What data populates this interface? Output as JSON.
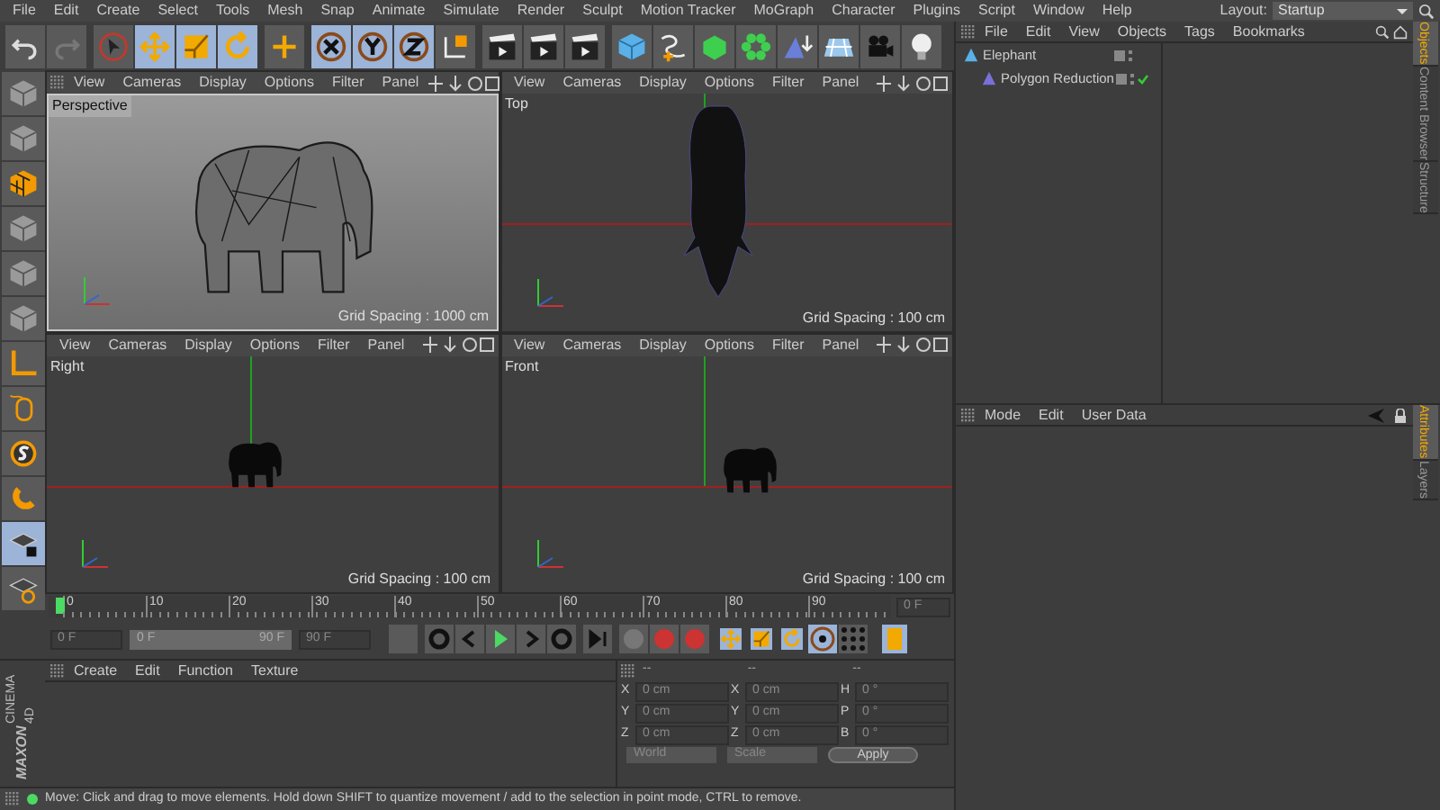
{
  "menu": [
    "File",
    "Edit",
    "Create",
    "Select",
    "Tools",
    "Mesh",
    "Snap",
    "Animate",
    "Simulate",
    "Render",
    "Sculpt",
    "Motion Tracker",
    "MoGraph",
    "Character",
    "Plugins",
    "Script",
    "Window",
    "Help"
  ],
  "layout": {
    "label": "Layout:",
    "value": "Startup"
  },
  "toolbar": [
    {
      "kind": "undo",
      "selected": false
    },
    {
      "kind": "redo",
      "selected": false
    },
    {
      "kind": "pointer",
      "selected": false
    },
    {
      "kind": "move",
      "selected": true
    },
    {
      "kind": "scale",
      "selected": true
    },
    {
      "kind": "rotate",
      "selected": true
    },
    {
      "kind": "add",
      "selected": false
    },
    {
      "kind": "x",
      "selected": true
    },
    {
      "kind": "y",
      "selected": true
    },
    {
      "kind": "z",
      "selected": true
    },
    {
      "kind": "coords",
      "selected": false
    },
    {
      "kind": "render",
      "selected": false
    },
    {
      "kind": "render",
      "selected": false
    },
    {
      "kind": "render",
      "selected": false
    },
    {
      "kind": "cube",
      "selected": false
    },
    {
      "kind": "spline",
      "selected": false
    },
    {
      "kind": "generator",
      "selected": false
    },
    {
      "kind": "array",
      "selected": false
    },
    {
      "kind": "deformer",
      "selected": false
    },
    {
      "kind": "floor",
      "selected": false
    },
    {
      "kind": "camera",
      "selected": false
    },
    {
      "kind": "light",
      "selected": false
    }
  ],
  "side_tools": [
    {
      "kind": "object",
      "selected": false
    },
    {
      "kind": "object",
      "selected": false
    },
    {
      "kind": "texture",
      "selected": false
    },
    {
      "kind": "object",
      "selected": false
    },
    {
      "kind": "object",
      "selected": false
    },
    {
      "kind": "object",
      "selected": false
    },
    {
      "kind": "angle",
      "selected": false
    },
    {
      "kind": "mouse",
      "selected": false
    },
    {
      "kind": "snap",
      "selected": false
    },
    {
      "kind": "magnet",
      "selected": false
    },
    {
      "kind": "lock",
      "selected": true
    },
    {
      "kind": "workplane",
      "selected": false
    }
  ],
  "viewports": [
    {
      "menu": [
        "View",
        "Cameras",
        "Display",
        "Options",
        "Filter",
        "Panel"
      ],
      "name": "Perspective",
      "kind": "perspective",
      "grid": "Grid Spacing : 1000 cm"
    },
    {
      "menu": [
        "View",
        "Cameras",
        "Display",
        "Options",
        "Filter",
        "Panel"
      ],
      "name": "Top",
      "kind": "top",
      "grid": "Grid Spacing : 100 cm"
    },
    {
      "menu": [
        "View",
        "Cameras",
        "Display",
        "Options",
        "Filter",
        "Panel"
      ],
      "name": "Right",
      "kind": "right",
      "grid": "Grid Spacing : 100 cm"
    },
    {
      "menu": [
        "View",
        "Cameras",
        "Display",
        "Options",
        "Filter",
        "Panel"
      ],
      "name": "Front",
      "kind": "front",
      "grid": "Grid Spacing : 100 cm"
    }
  ],
  "timeline": {
    "ruler": [
      "0",
      "10",
      "20",
      "30",
      "40",
      "50",
      "60",
      "70",
      "80",
      "90"
    ],
    "current": "0 F",
    "start": "0 F",
    "range_start": "0 F",
    "range_end": "90 F",
    "range": {
      "level": 1
    },
    "end": "90 F"
  },
  "material_menu": [
    "Create",
    "Edit",
    "Function",
    "Texture"
  ],
  "logo": {
    "brand": "MAXON",
    "product": "CINEMA 4D"
  },
  "coordinates": {
    "headers": [
      "--",
      "--",
      "--"
    ],
    "rows": [
      [
        "X",
        "0 cm",
        "X",
        "0 cm",
        "H",
        "0 °"
      ],
      [
        "Y",
        "0 cm",
        "Y",
        "0 cm",
        "P",
        "0 °"
      ],
      [
        "Z",
        "0 cm",
        "Z",
        "0 cm",
        "B",
        "0 °"
      ]
    ],
    "mode": "World",
    "transform": "Scale",
    "apply": "Apply"
  },
  "status": "Move: Click and drag to move elements. Hold down SHIFT to quantize movement / add to the selection in point mode, CTRL to remove.",
  "objects_menu": [
    "File",
    "Edit",
    "View",
    "Objects",
    "Tags",
    "Bookmarks"
  ],
  "objects": [
    {
      "name": "Elephant",
      "kind": "polygon",
      "checked": false,
      "children": [
        {
          "name": "Polygon Reduction",
          "kind": "generator",
          "checked": true
        }
      ]
    }
  ],
  "attributes_menu": [
    "Mode",
    "Edit",
    "User Data"
  ],
  "side_tabs": [
    {
      "label": "Objects",
      "selected": true
    },
    {
      "label": "Content Browser",
      "selected": false
    },
    {
      "label": "Structure",
      "selected": false
    }
  ],
  "side_tabs_lower": [
    {
      "label": "Attributes",
      "selected": true
    },
    {
      "label": "Layers",
      "selected": false
    }
  ]
}
